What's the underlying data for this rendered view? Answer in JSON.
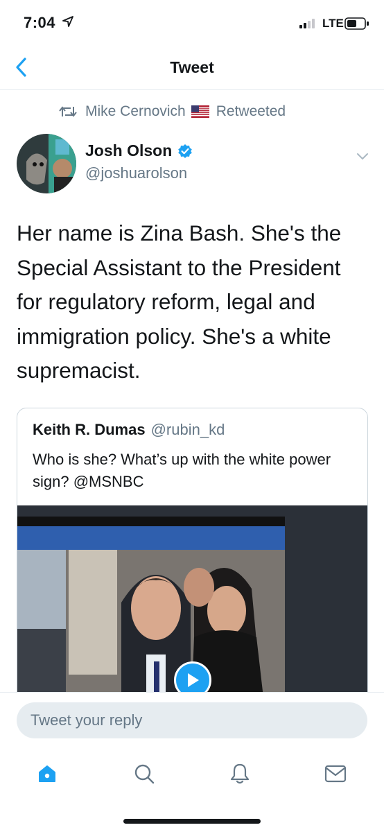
{
  "status_bar": {
    "time": "7:04",
    "network": "LTE"
  },
  "nav": {
    "title": "Tweet"
  },
  "retweet_context": {
    "retweeter": "Mike Cernovich",
    "action": "Retweeted"
  },
  "author": {
    "name": "Josh Olson",
    "handle": "@joshuarolson",
    "verified": true
  },
  "tweet": {
    "text": "Her name is Zina Bash. She's the Special Assistant to the President for regulatory reform, legal and immigration policy. She's a white supremacist."
  },
  "quoted_tweet": {
    "name": "Keith R. Dumas",
    "handle": "@rubin_kd",
    "text": "Who is she? What’s up with the white power sign? @MSNBC",
    "media_type": "video"
  },
  "reply": {
    "placeholder": "Tweet your reply"
  },
  "tab_bar": {
    "tabs": [
      "home-icon",
      "search-icon",
      "notifications-icon",
      "messages-icon"
    ],
    "active": "home-icon"
  },
  "colors": {
    "accent": "#1da1f2",
    "secondary_text": "#657786",
    "primary_text": "#14171a",
    "divider": "#e6ecf0"
  }
}
